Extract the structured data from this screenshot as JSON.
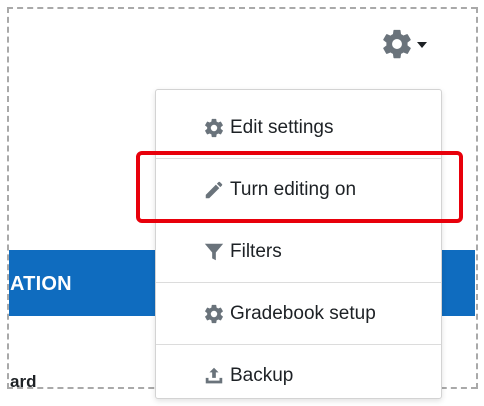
{
  "page": {
    "banner_text": "ATION",
    "bottom_text": "ard"
  },
  "actions_menu": {
    "trigger_icon": "gear-icon",
    "items": [
      {
        "label": "Edit settings",
        "icon": "gear-icon"
      },
      {
        "label": "Turn editing on",
        "icon": "pencil-icon"
      },
      {
        "label": "Filters",
        "icon": "filter-icon"
      },
      {
        "label": "Gradebook setup",
        "icon": "gear-icon"
      },
      {
        "label": "Backup",
        "icon": "upload-icon"
      }
    ]
  },
  "colors": {
    "banner": "#0f6cbf",
    "highlight": "#e8000b",
    "icon": "#6a737b"
  }
}
